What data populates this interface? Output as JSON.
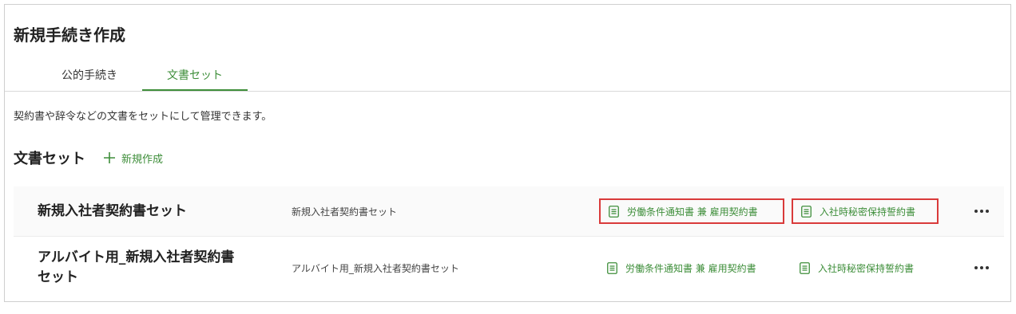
{
  "page": {
    "title": "新規手続き作成"
  },
  "tabs": [
    {
      "label": "公的手続き",
      "active": false
    },
    {
      "label": "文書セット",
      "active": true
    }
  ],
  "description": "契約書や辞令などの文書をセットにして管理できます。",
  "section": {
    "title": "文書セット",
    "new_button_label": "新規作成",
    "new_button_icon": "plus-icon"
  },
  "document_sets": [
    {
      "name": "新規入社者契約書セット",
      "description": "新規入社者契約書セット",
      "documents": [
        "労働条件通知書 兼 雇用契約書",
        "入社時秘密保持誓約書"
      ],
      "highlighted": true
    },
    {
      "name": "アルバイト用_新規入社者契約書セット",
      "description": "アルバイト用_新規入社者契約書セット",
      "documents": [
        "労働条件通知書 兼 雇用契約書",
        "入社時秘密保持誓約書"
      ],
      "highlighted": false
    }
  ],
  "colors": {
    "accent": "#3e8e3a",
    "highlight_border": "#d93a3a"
  },
  "icons": {
    "document": "document-icon",
    "more": "more-options-icon"
  }
}
